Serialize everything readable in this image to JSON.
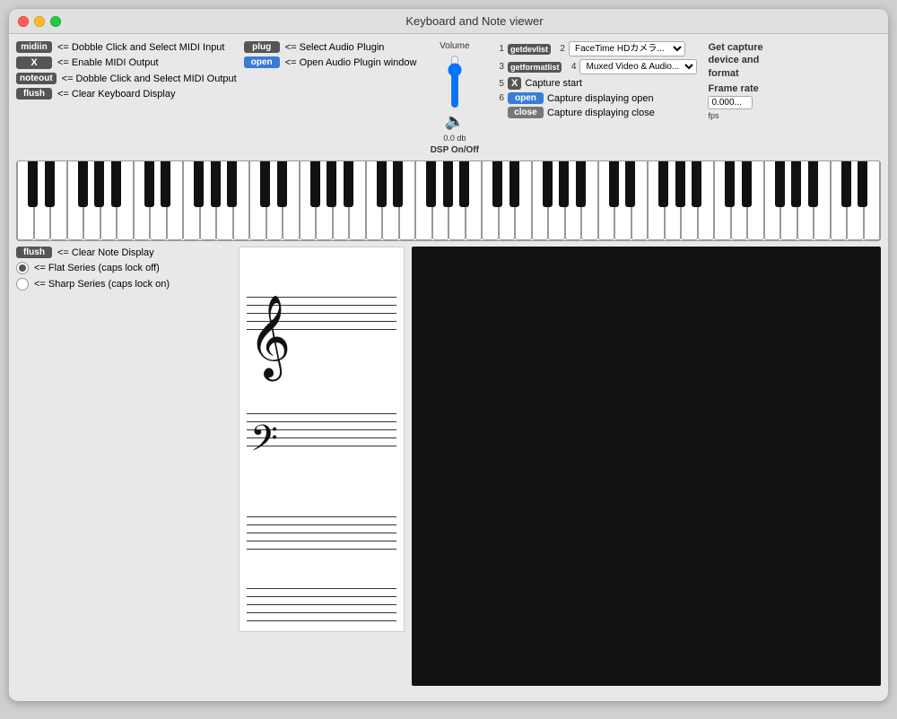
{
  "window": {
    "title": "Keyboard and Note viewer"
  },
  "traffic_lights": {
    "close": "close",
    "minimize": "minimize",
    "maximize": "maximize"
  },
  "midi_section": {
    "midiin_badge": "midiin",
    "midiin_label": "<= Dobble Click and Select MIDI Input",
    "x_badge": "X",
    "x_label": "<= Enable MIDI Output",
    "noteout_badge": "noteout",
    "noteout_label": "<= Dobble Click and Select MIDI Output",
    "flush_badge": "flush",
    "flush_label": "<= Clear Keyboard Display"
  },
  "plugin_section": {
    "plug_badge": "plug",
    "plug_label": "<= Select Audio Plugin",
    "open_badge": "open",
    "open_label": "<= Open Audio Plugin window"
  },
  "volume": {
    "label": "Volume",
    "db_value": "0.0 db"
  },
  "dsp": {
    "label": "DSP On/Off"
  },
  "capture": {
    "num1": "1",
    "getdevlist_badge": "getdevlist",
    "device1_value": "FaceTime HDカメラ...",
    "num2": "3",
    "getformatlist_badge": "getformatlist",
    "device2_value": "Muxed Video & Audio...",
    "num3": "5",
    "x_badge": "X",
    "capture_start_label": "Capture start",
    "num4": "6",
    "open_badge": "open",
    "open_label": "Capture displaying open",
    "close_badge": "close",
    "close_label": "Capture displaying close",
    "num_col2_1": "2",
    "num_col2_2": "4",
    "get_text1": "Get capture",
    "get_text2": "device and",
    "get_text3": "format"
  },
  "frame_rate": {
    "label": "Frame rate",
    "value": "0.000...",
    "unit": "fps"
  },
  "note_controls": {
    "flush_badge": "flush",
    "flush_label": "<= Clear Note Display",
    "flat_label": "<= Flat Series (caps lock off)",
    "sharp_label": "<= Sharp Series (caps lock on)"
  }
}
